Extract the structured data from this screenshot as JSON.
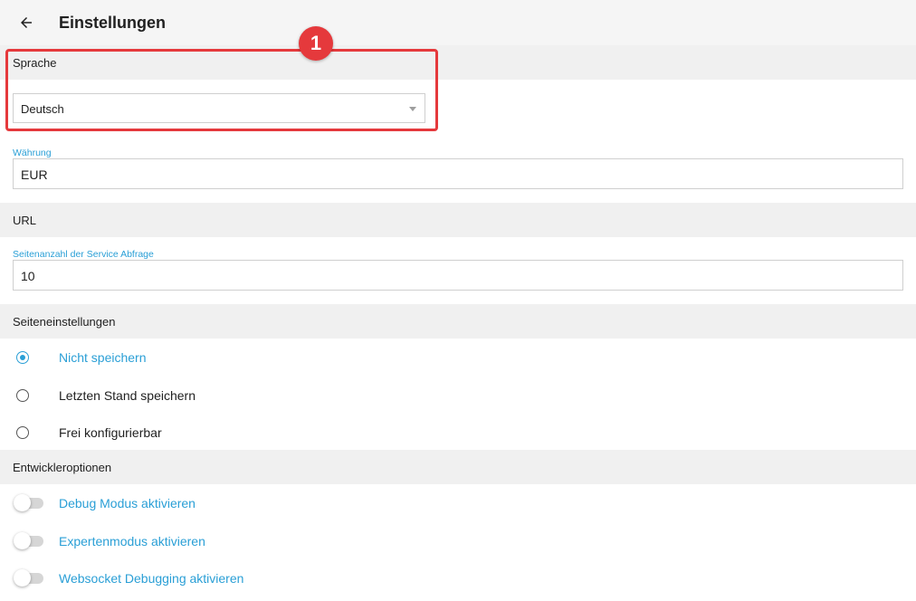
{
  "header": {
    "title": "Einstellungen",
    "back_icon": "arrow-left-icon"
  },
  "language": {
    "section_title": "Sprache",
    "selected": "Deutsch"
  },
  "currency": {
    "label": "Währung",
    "value": "EUR"
  },
  "url_section": {
    "title": "URL"
  },
  "page_count": {
    "label": "Seitenanzahl der Service Abfrage",
    "value": "10"
  },
  "page_settings": {
    "title": "Seiteneinstellungen",
    "options": [
      {
        "label": "Nicht speichern",
        "checked": true
      },
      {
        "label": "Letzten Stand speichern",
        "checked": false
      },
      {
        "label": "Frei konfigurierbar",
        "checked": false
      }
    ]
  },
  "developer": {
    "title": "Entwickleroptionen",
    "toggles": [
      {
        "label": "Debug Modus aktivieren",
        "on": false
      },
      {
        "label": "Expertenmodus aktivieren",
        "on": false
      },
      {
        "label": "Websocket Debugging aktivieren",
        "on": false
      }
    ]
  },
  "annotation": {
    "step": "1",
    "color": "#e5393c"
  },
  "colors": {
    "accent": "#2a9fd6",
    "section_bg": "#f0f0f0"
  }
}
